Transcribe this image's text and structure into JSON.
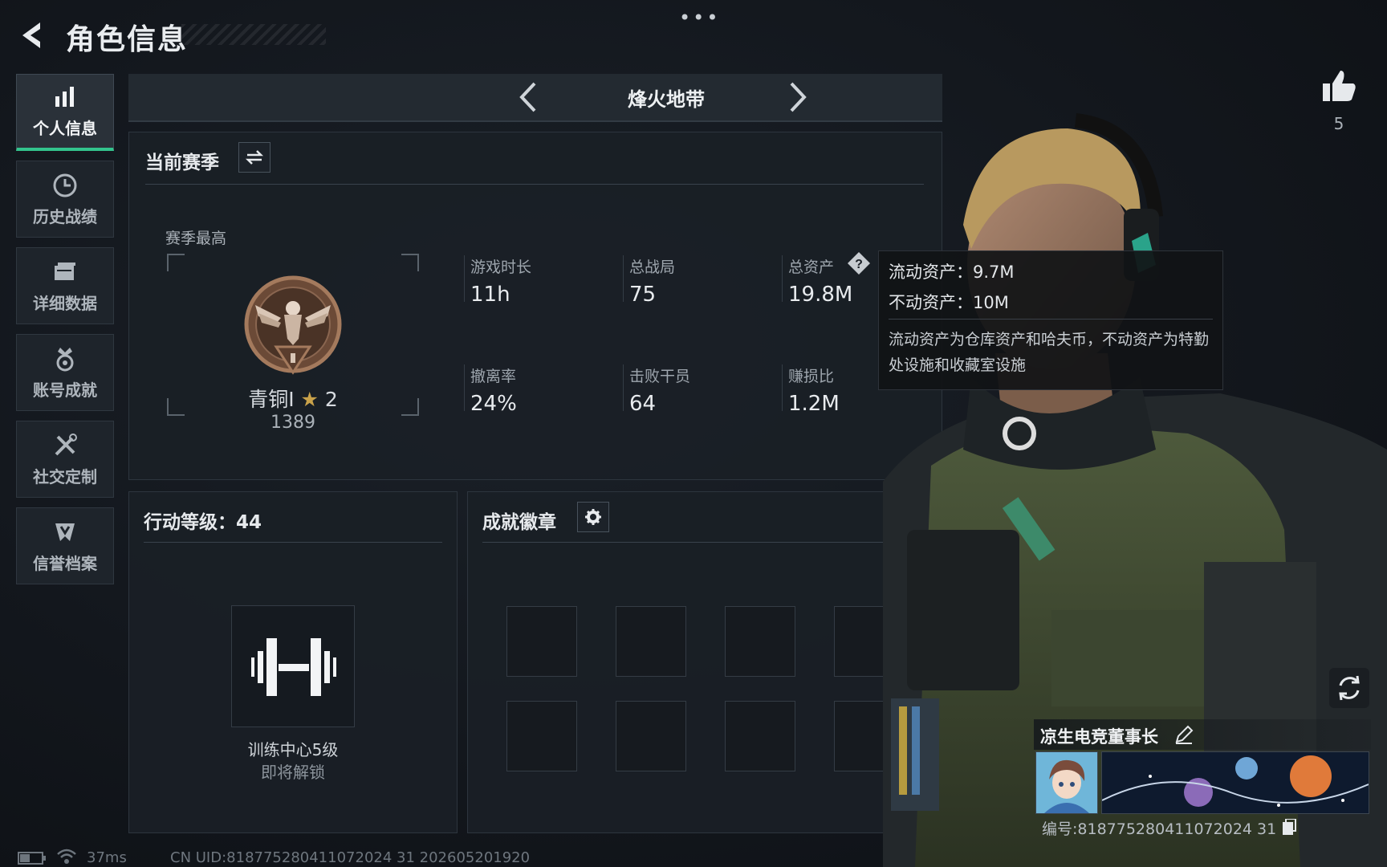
{
  "header": {
    "title": "角色信息",
    "more_dots": "•••"
  },
  "nav": {
    "items": [
      {
        "label": "个人信息",
        "icon": "bar-chart-icon",
        "active": true
      },
      {
        "label": "历史战绩",
        "icon": "clock-icon",
        "active": false
      },
      {
        "label": "详细数据",
        "icon": "folder-icon",
        "active": false
      },
      {
        "label": "账号成就",
        "icon": "medal-icon",
        "active": false
      },
      {
        "label": "社交定制",
        "icon": "tools-icon",
        "active": false
      },
      {
        "label": "信誉档案",
        "icon": "shield-icon",
        "active": false
      }
    ]
  },
  "mode": {
    "title": "烽火地带"
  },
  "season": {
    "heading": "当前赛季",
    "best_label": "赛季最高",
    "rank_name": "青铜I",
    "rank_stars": "2",
    "rank_score": "1389",
    "stats": [
      {
        "label": "游戏时长",
        "value": "11h"
      },
      {
        "label": "总战局",
        "value": "75"
      },
      {
        "label": "总资产",
        "value": "19.8M"
      },
      {
        "label": "撤离率",
        "value": "24%"
      },
      {
        "label": "击败干员",
        "value": "64"
      },
      {
        "label": "赚损比",
        "value": "1.2M"
      }
    ]
  },
  "tooltip": {
    "liquid": "流动资产：9.7M",
    "fixed": "不动资产：10M",
    "description": "流动资产为仓库资产和哈夫币，不动资产为特勤处设施和收藏室设施"
  },
  "level": {
    "heading": "行动等级：44",
    "lock_title": "训练中心5级",
    "lock_sub": "即将解锁"
  },
  "badges": {
    "heading": "成就徽章"
  },
  "player": {
    "likes": "5",
    "name": "凉生电竞董事长",
    "id_text": "编号:818775280411072024 31"
  },
  "status_bar": {
    "ping": "37ms",
    "uid_text": "CN UID:818775280411072024 31 202605201920"
  },
  "colors": {
    "accent": "#33c48d",
    "panel": "#1a1f26",
    "gold": "#c9a24a"
  }
}
